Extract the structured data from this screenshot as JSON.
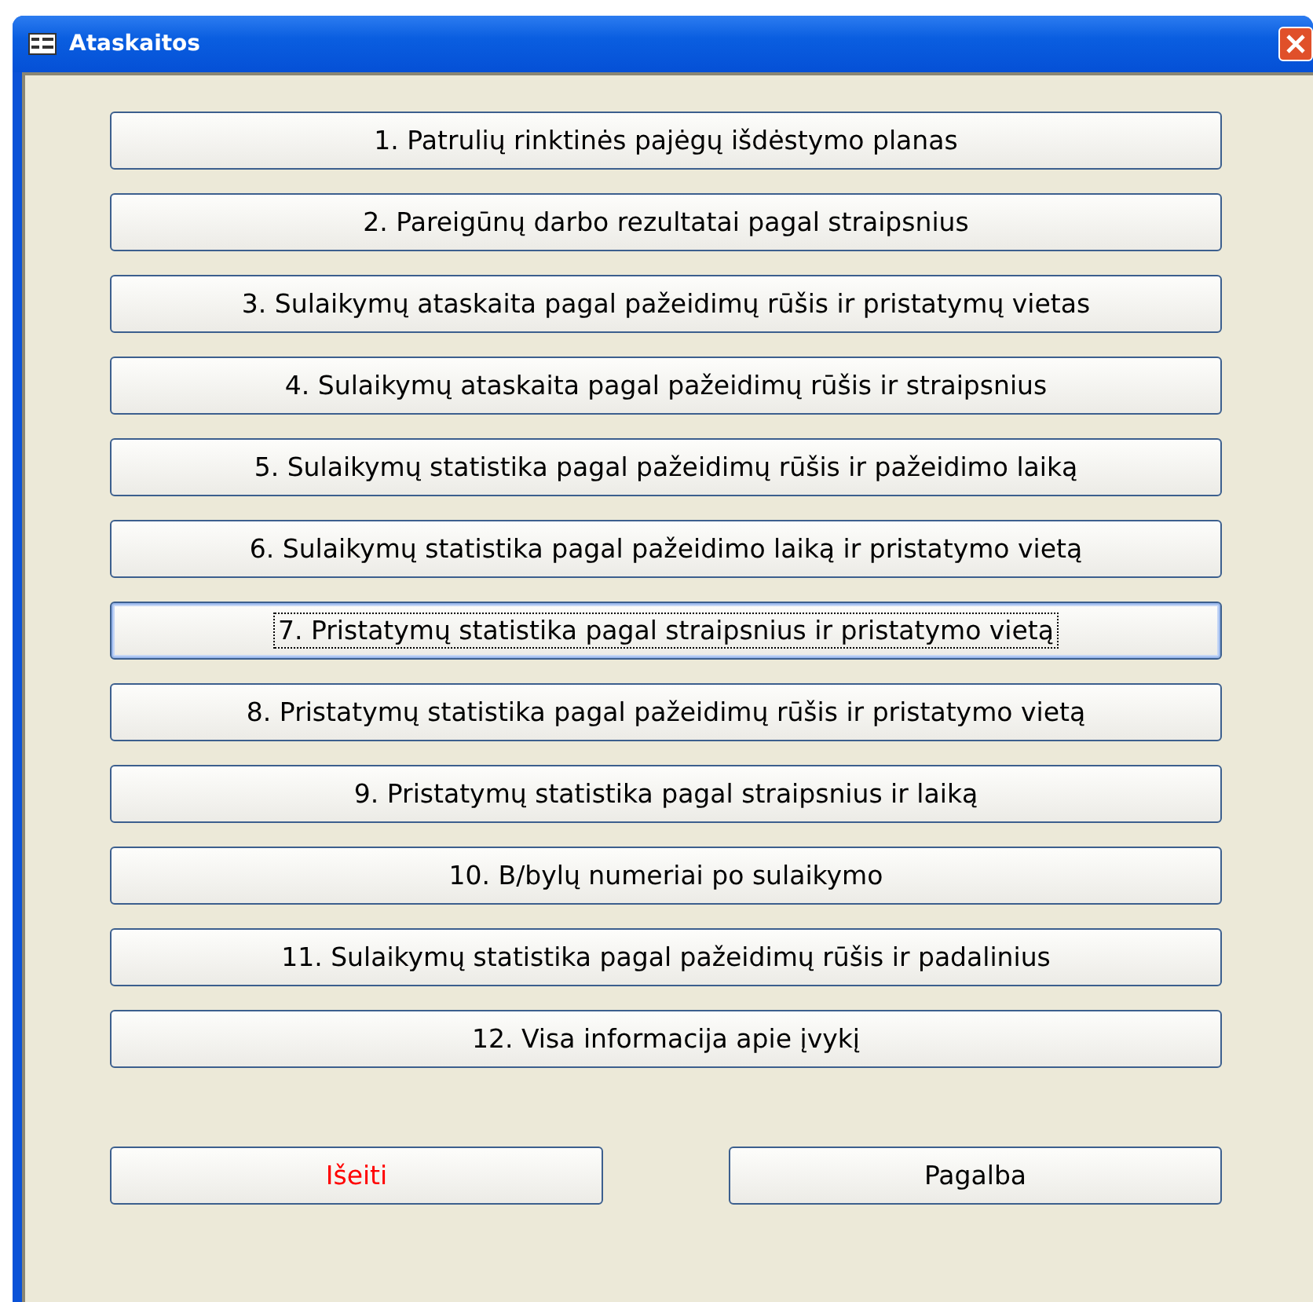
{
  "window": {
    "title": "Ataskaitos"
  },
  "reports": [
    {
      "label": "1. Patrulių rinktinės pajėgų išdėstymo planas",
      "focused": false
    },
    {
      "label": "2. Pareigūnų darbo rezultatai pagal straipsnius",
      "focused": false
    },
    {
      "label": "3. Sulaikymų ataskaita pagal pažeidimų rūšis ir pristatymų vietas",
      "focused": false
    },
    {
      "label": "4. Sulaikymų ataskaita pagal pažeidimų rūšis ir straipsnius",
      "focused": false
    },
    {
      "label": "5. Sulaikymų statistika pagal pažeidimų rūšis ir pažeidimo laiką",
      "focused": false
    },
    {
      "label": "6. Sulaikymų statistika pagal pažeidimo laiką ir pristatymo vietą",
      "focused": false
    },
    {
      "label": "7. Pristatymų statistika pagal straipsnius ir pristatymo vietą",
      "focused": true
    },
    {
      "label": "8. Pristatymų statistika pagal pažeidimų rūšis ir pristatymo vietą",
      "focused": false
    },
    {
      "label": "9. Pristatymų statistika pagal straipsnius ir laiką",
      "focused": false
    },
    {
      "label": "10. B/bylų numeriai po sulaikymo",
      "focused": false
    },
    {
      "label": "11. Sulaikymų statistika pagal pažeidimų rūšis ir padalinius",
      "focused": false
    },
    {
      "label": "12. Visa informacija apie įvykį",
      "focused": false
    }
  ],
  "actions": [
    {
      "label": "Išeiti",
      "kind": "exit"
    },
    {
      "label": "Pagalba",
      "kind": "help"
    }
  ]
}
